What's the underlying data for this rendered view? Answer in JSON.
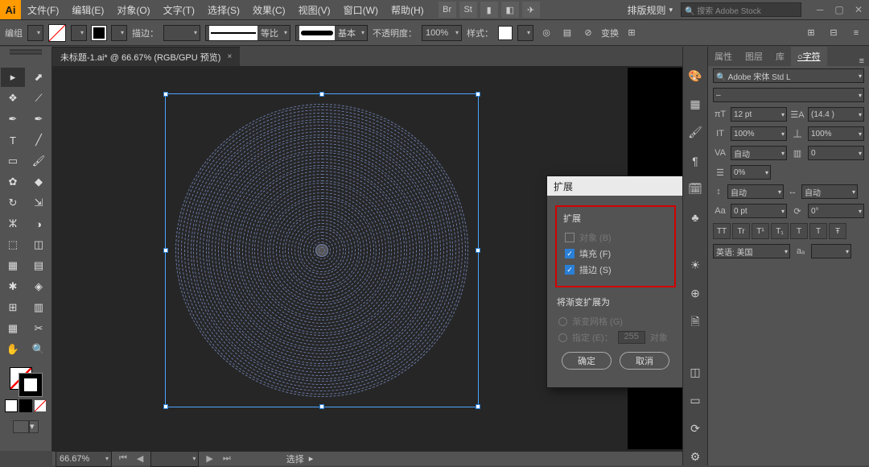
{
  "app_logo": "Ai",
  "menu": [
    "文件(F)",
    "编辑(E)",
    "对象(O)",
    "文字(T)",
    "选择(S)",
    "效果(C)",
    "视图(V)",
    "窗口(W)",
    "帮助(H)"
  ],
  "top_badges": [
    "Br",
    "St",
    "▮",
    "◧",
    "✈"
  ],
  "layout_dropdown": "排版规则",
  "stock_search_placeholder": "🔍 搜索 Adobe Stock",
  "control": {
    "left_label": "编组",
    "stroke_label": "描边：",
    "stroke_pt": "",
    "brush_preset": "等比",
    "style_preset": "基本",
    "opacity_label": "不透明度：",
    "opacity_value": "100%",
    "style_label": "样式：",
    "transform_label": "变换"
  },
  "doc_tab": {
    "title": "未标题-1.ai* @ 66.67% (RGB/GPU 预览)",
    "close": "×"
  },
  "tools": [
    {
      "g": "▸",
      "n": "selection-tool"
    },
    {
      "g": "⬈",
      "n": "direct-selection-tool"
    },
    {
      "g": "❖",
      "n": "magic-wand-tool"
    },
    {
      "g": "⟋",
      "n": "lasso-tool"
    },
    {
      "g": "✒",
      "n": "pen-tool"
    },
    {
      "g": "✒",
      "n": "curvature-tool"
    },
    {
      "g": "T",
      "n": "type-tool"
    },
    {
      "g": "╱",
      "n": "line-tool"
    },
    {
      "g": "▭",
      "n": "rectangle-tool"
    },
    {
      "g": "🖌",
      "n": "paintbrush-tool"
    },
    {
      "g": "✿",
      "n": "shaper-tool"
    },
    {
      "g": "◆",
      "n": "eraser-tool"
    },
    {
      "g": "↻",
      "n": "rotate-tool"
    },
    {
      "g": "⇲",
      "n": "scale-tool"
    },
    {
      "g": "ⵣ",
      "n": "width-tool"
    },
    {
      "g": "◑",
      "n": "free-transform-tool"
    },
    {
      "g": "⬚",
      "n": "shape-builder-tool"
    },
    {
      "g": "◫",
      "n": "perspective-grid-tool"
    },
    {
      "g": "▦",
      "n": "mesh-tool"
    },
    {
      "g": "▤",
      "n": "gradient-tool"
    },
    {
      "g": "✱",
      "n": "eyedropper-tool"
    },
    {
      "g": "◈",
      "n": "blend-tool"
    },
    {
      "g": "⊞",
      "n": "symbol-sprayer-tool"
    },
    {
      "g": "▥",
      "n": "column-graph-tool"
    },
    {
      "g": "▦",
      "n": "artboard-tool"
    },
    {
      "g": "✂",
      "n": "slice-tool"
    },
    {
      "g": "✋",
      "n": "hand-tool"
    },
    {
      "g": "🔍",
      "n": "zoom-tool"
    }
  ],
  "dock_icons": [
    {
      "g": "🎨",
      "n": "color-panel-icon"
    },
    {
      "g": "▦",
      "n": "swatches-panel-icon"
    },
    {
      "g": "🖌",
      "n": "brushes-panel-icon"
    },
    {
      "g": "¶",
      "n": "paragraph-panel-icon"
    },
    {
      "g": "🗓",
      "n": "symbols-panel-icon"
    },
    {
      "g": "♣",
      "n": "graphic-styles-panel-icon"
    },
    {
      "g": "☀",
      "n": "appearance-panel-icon"
    },
    {
      "g": "⊕",
      "n": "transparency-panel-icon"
    },
    {
      "g": "🗎",
      "n": "layers-panel-icon"
    },
    {
      "g": "◫",
      "n": "asset-export-panel-icon"
    },
    {
      "g": "▭",
      "n": "artboards-panel-icon"
    },
    {
      "g": "⟳",
      "n": "links-panel-icon"
    },
    {
      "g": "⚙",
      "n": "actions-panel-icon"
    }
  ],
  "char_panel": {
    "tabs": [
      "属性",
      "图层",
      "库",
      "○字符"
    ],
    "font_family": "🔍 Adobe 宋体 Std L",
    "font_style": "–",
    "size_icon": "πT",
    "size": "12 pt",
    "leading_icon": "☰A",
    "leading": "(14.4 )",
    "vscale_icon": "IT",
    "vscale": "100%",
    "hscale_icon": "丄",
    "hscale": "100%",
    "kern_icon": "VA",
    "kerning": "自动",
    "track_icon": "▥",
    "tracking": "0",
    "baseline_icon": "☰",
    "baseline": "0%",
    "rot_icon": "↕",
    "rotation": "自动",
    "shift_icon": "Aa",
    "shift": "0 pt",
    "ang_icon": "⟳",
    "angle": "0°",
    "caps": [
      "TT",
      "Tr",
      "T¹",
      "T₁",
      "T",
      "T",
      "Ŧ"
    ],
    "lang_label": "英语: 美国",
    "aa_label": "aₐ"
  },
  "dialog": {
    "title": "扩展",
    "section": "扩展",
    "cb_object": "对象 (B)",
    "cb_fill": "填充 (F)",
    "cb_stroke": "描边 (S)",
    "section2": "将渐变扩展为",
    "r_mesh": "渐变网格 (G)",
    "r_specify": "指定 (E)：",
    "r_specify_value": "255",
    "r_specify_unit": "对象",
    "ok": "确定",
    "cancel": "取消"
  },
  "status": {
    "zoom": "66.67%",
    "label": "选择"
  }
}
